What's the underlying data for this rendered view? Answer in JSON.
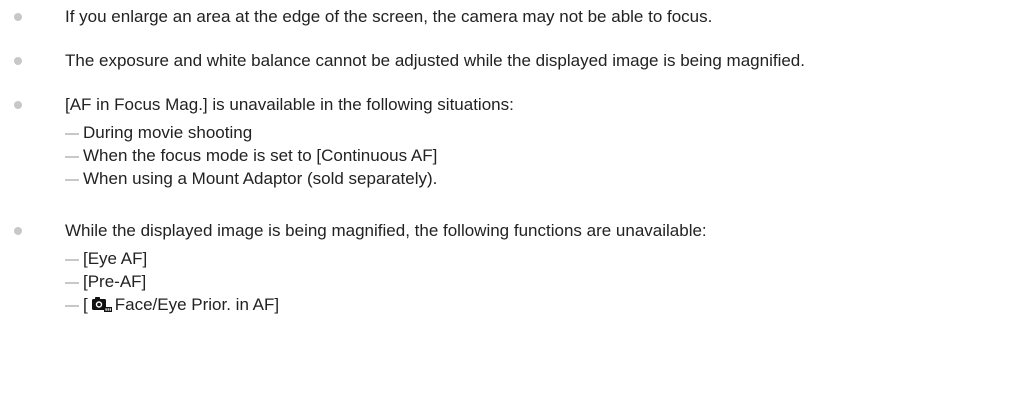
{
  "notes": [
    {
      "text": "If you enlarge an area at the edge of the screen, the camera may not be able to focus."
    },
    {
      "text": "The exposure and white balance cannot be adjusted while the displayed image is being magnified."
    },
    {
      "text": "[AF in Focus Mag.] is unavailable in the following situations:",
      "subitems": [
        "During movie shooting",
        "When the focus mode is set to [Continuous AF]",
        "When using a Mount Adaptor (sold separately)."
      ]
    },
    {
      "text": "While the displayed image is being magnified, the following functions are unavailable:",
      "subitems": [
        "[Eye AF]",
        "[Pre-AF]"
      ],
      "icon_subitem": {
        "prefix": "[",
        "icon": "camera-icon",
        "suffix": "Face/Eye Prior. in AF]"
      }
    }
  ],
  "colors": {
    "text": "#222222",
    "bullet": "#c8c8c8"
  }
}
